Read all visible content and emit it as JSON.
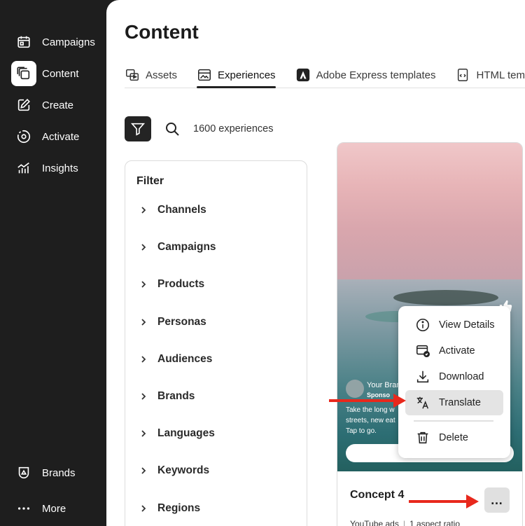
{
  "sidebar": {
    "items": [
      {
        "label": "Campaigns",
        "icon": "calendar-icon"
      },
      {
        "label": "Content",
        "icon": "content-stack-icon",
        "active": true
      },
      {
        "label": "Create",
        "icon": "edit-icon"
      },
      {
        "label": "Activate",
        "icon": "target-icon"
      },
      {
        "label": "Insights",
        "icon": "chart-icon"
      }
    ],
    "bottom": [
      {
        "label": "Brands",
        "icon": "brand-shield-icon"
      },
      {
        "label": "More",
        "icon": "ellipsis-icon"
      }
    ]
  },
  "page": {
    "title": "Content"
  },
  "tabs": [
    {
      "label": "Assets",
      "icon": "assets-icon"
    },
    {
      "label": "Experiences",
      "icon": "experiences-icon",
      "active": true
    },
    {
      "label": "Adobe Express templates",
      "icon": "adobe-express-icon"
    },
    {
      "label": "HTML templates",
      "icon": "html-template-icon"
    }
  ],
  "toolbar": {
    "count_text": "1600 experiences"
  },
  "filter": {
    "title": "Filter",
    "items": [
      "Channels",
      "Campaigns",
      "Products",
      "Personas",
      "Audiences",
      "Brands",
      "Languages",
      "Keywords",
      "Regions"
    ]
  },
  "card": {
    "brand_name": "Your Bran",
    "sponsored": "Sponso",
    "ad_copy": [
      "Take the long w",
      "streets, new eat",
      "Tap to go."
    ],
    "title": "Concept 4",
    "more_label": "…",
    "meta": [
      "YouTube ads",
      "1 aspect ratio"
    ]
  },
  "context_menu": {
    "items": [
      {
        "label": "View Details",
        "icon": "info-icon"
      },
      {
        "label": "Activate",
        "icon": "activate-card-icon"
      },
      {
        "label": "Download",
        "icon": "download-icon"
      },
      {
        "label": "Translate",
        "icon": "translate-icon",
        "hover": true
      },
      {
        "label": "Delete",
        "icon": "trash-icon"
      }
    ]
  },
  "colors": {
    "sidebar_bg": "#1e1e1e",
    "arrow": "#e8281c",
    "menu_hover": "#e4e4e4"
  }
}
